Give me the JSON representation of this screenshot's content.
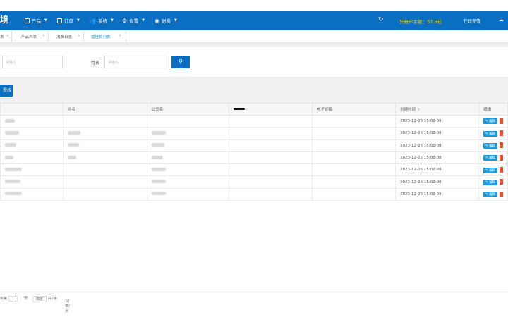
{
  "header": {
    "logo": "境",
    "logo_sub": "...",
    "menu": [
      {
        "label": "产品",
        "icon": "product-icon"
      },
      {
        "label": "订单",
        "icon": "order-icon"
      },
      {
        "label": "系统",
        "icon": "users-icon"
      },
      {
        "label": "设置",
        "icon": "gear-icon"
      },
      {
        "label": "财务",
        "icon": "finance-icon"
      }
    ],
    "refresh_icon": "refresh-icon",
    "balance": "只账户余额：37.6元",
    "recharge": "在线充值",
    "cloud_icon": "cloud-icon",
    "accent": "#0a6fc2",
    "balance_color": "#f0d000"
  },
  "tabs": [
    {
      "label": "表",
      "active": false
    },
    {
      "label": "产品列表",
      "active": false
    },
    {
      "label": "消费日志",
      "active": false
    },
    {
      "label": "管理员列表",
      "active": true
    }
  ],
  "filters": {
    "first_placeholder": "请输入",
    "name_label": "姓名",
    "name_placeholder": "请输入",
    "search_icon": "search-icon"
  },
  "toolbar": {
    "auth_button": "授权"
  },
  "table": {
    "headers": [
      "",
      "姓名",
      "公司名",
      "",
      "电子邮箱",
      "创建时间",
      "编辑"
    ],
    "sort_icon": "sort-icon",
    "edit_label": "编辑",
    "rows": [
      {
        "created": "2023-12-26 15:02:08"
      },
      {
        "created": "2023-12-26 15:02:08"
      },
      {
        "created": "2023-12-26 15:02:08"
      },
      {
        "created": "2023-12-26 15:02:08"
      },
      {
        "created": "2023-12-26 15:02:08"
      },
      {
        "created": "2023-12-26 15:02:08"
      },
      {
        "created": "2023-12-26 15:02:08"
      }
    ]
  },
  "pager": {
    "prefix": "到第",
    "page": "1",
    "page_suffix": "页",
    "confirm": "确定",
    "total": "共7条",
    "per_page": "10条/页"
  }
}
